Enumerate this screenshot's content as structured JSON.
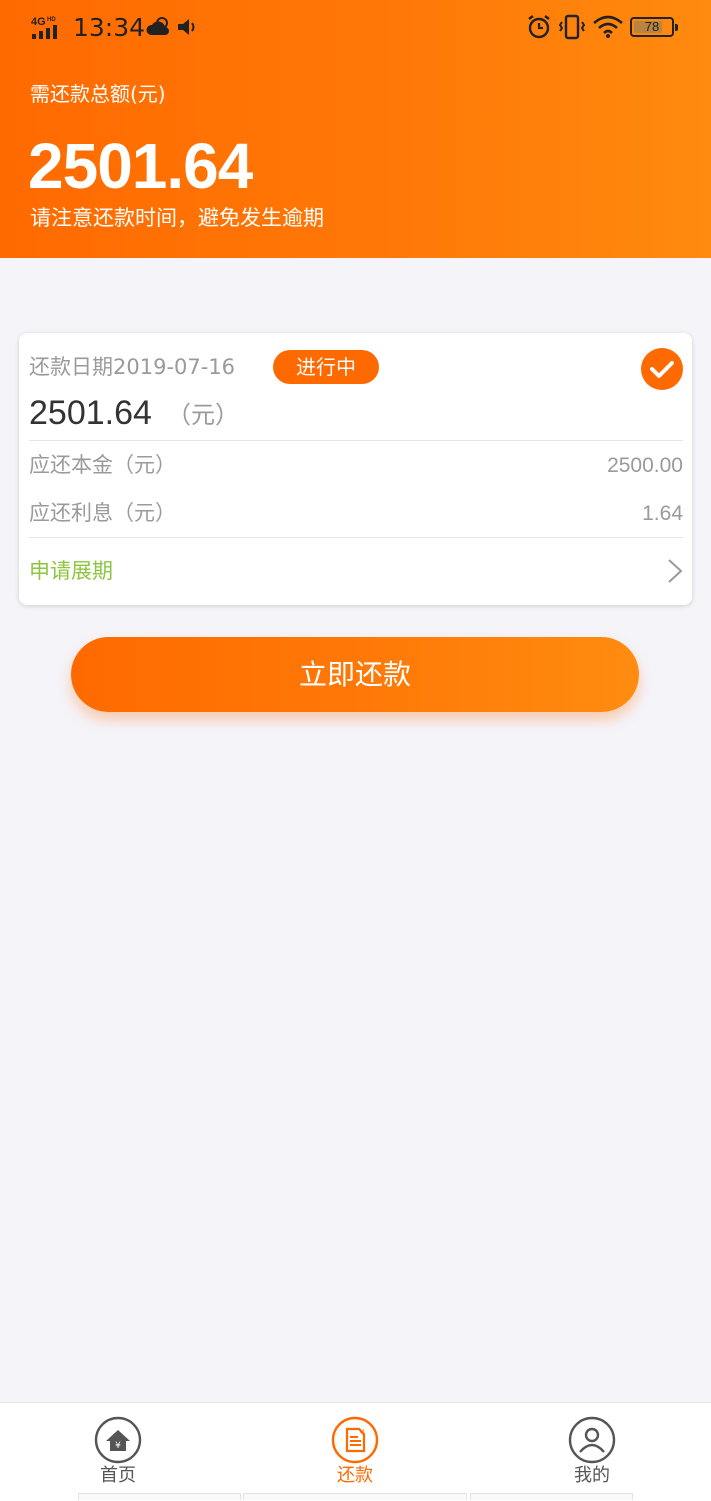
{
  "status_bar": {
    "network": "4G HD",
    "time": "13:34",
    "battery": "78",
    "battery_level": 0.78,
    "icons": [
      "signal-icon",
      "cloud-icon",
      "speaker-icon",
      "alarm-icon",
      "vibrate-icon",
      "wifi-icon",
      "battery-icon"
    ]
  },
  "header": {
    "total_label": "需还款总额(元)",
    "total_amount": "2501.64",
    "hint": "请注意还款时间，避免发生逾期"
  },
  "bill_card": {
    "date_label": "还款日期2019-07-16",
    "status_badge": "进行中",
    "amount": "2501.64",
    "amount_unit": "（元）",
    "principal_label": "应还本金（元）",
    "principal_value": "2500.00",
    "interest_label": "应还利息（元）",
    "interest_value": "1.64",
    "extend_label": "申请展期",
    "selected": true
  },
  "pay_button": {
    "label": "立即还款"
  },
  "tab_bar": {
    "tabs": [
      {
        "label": "首页",
        "icon": "home-icon",
        "active": false
      },
      {
        "label": "还款",
        "icon": "bill-icon",
        "active": true
      },
      {
        "label": "我的",
        "icon": "user-icon",
        "active": false
      }
    ]
  },
  "colors": {
    "brand_orange": "#ff6a00",
    "link_green": "#8cc63f",
    "background": "#f5f4f9",
    "muted_text": "#9a9a9a"
  }
}
